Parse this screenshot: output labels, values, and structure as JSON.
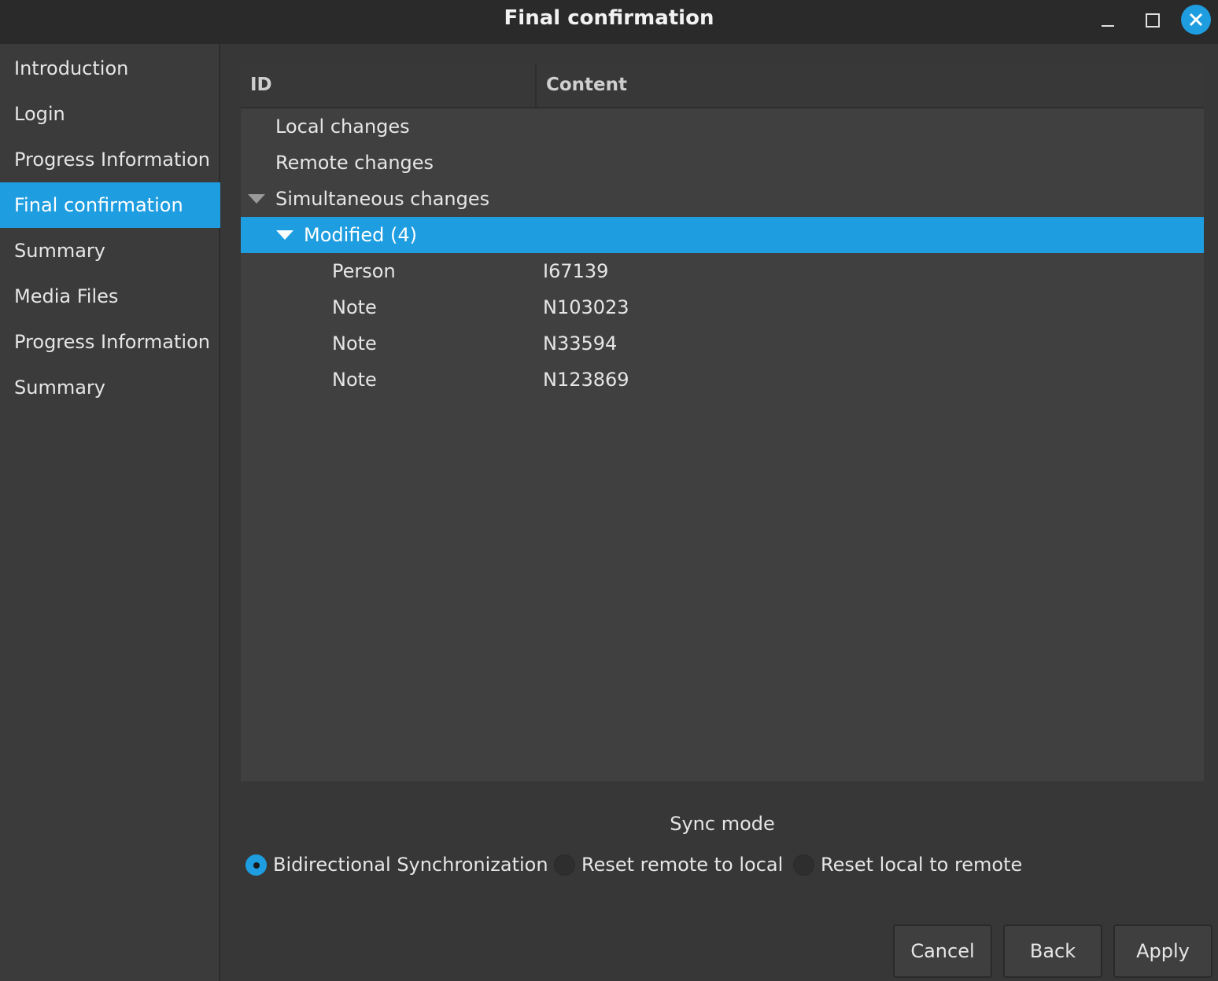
{
  "window": {
    "title": "Final confirmation"
  },
  "sidebar": {
    "items": [
      {
        "label": "Introduction"
      },
      {
        "label": "Login"
      },
      {
        "label": "Progress Information"
      },
      {
        "label": "Final confirmation",
        "active": true
      },
      {
        "label": "Summary"
      },
      {
        "label": "Media Files"
      },
      {
        "label": "Progress Information"
      },
      {
        "label": "Summary"
      }
    ]
  },
  "tree": {
    "columns": {
      "id": "ID",
      "content": "Content"
    },
    "rows": [
      {
        "id": "Local changes",
        "content": ""
      },
      {
        "id": "Remote changes",
        "content": ""
      },
      {
        "id": "Simultaneous changes",
        "content": "",
        "expanded": true
      },
      {
        "id": "Modified (4)",
        "content": "",
        "expanded": true,
        "selected": true
      },
      {
        "id": "Person",
        "content": "I67139"
      },
      {
        "id": "Note",
        "content": "N103023"
      },
      {
        "id": "Note",
        "content": "N33594"
      },
      {
        "id": "Note",
        "content": "N123869"
      }
    ]
  },
  "sync": {
    "label": "Sync mode",
    "options": [
      {
        "label": "Bidirectional Synchronization",
        "selected": true
      },
      {
        "label": "Reset remote to local",
        "selected": false
      },
      {
        "label": "Reset local to remote",
        "selected": false
      }
    ]
  },
  "buttons": {
    "cancel": "Cancel",
    "back": "Back",
    "apply": "Apply"
  },
  "colors": {
    "accent": "#1e9de0",
    "background": "#373737",
    "sidebar": "#3b3b3b",
    "tree": "#404040"
  }
}
